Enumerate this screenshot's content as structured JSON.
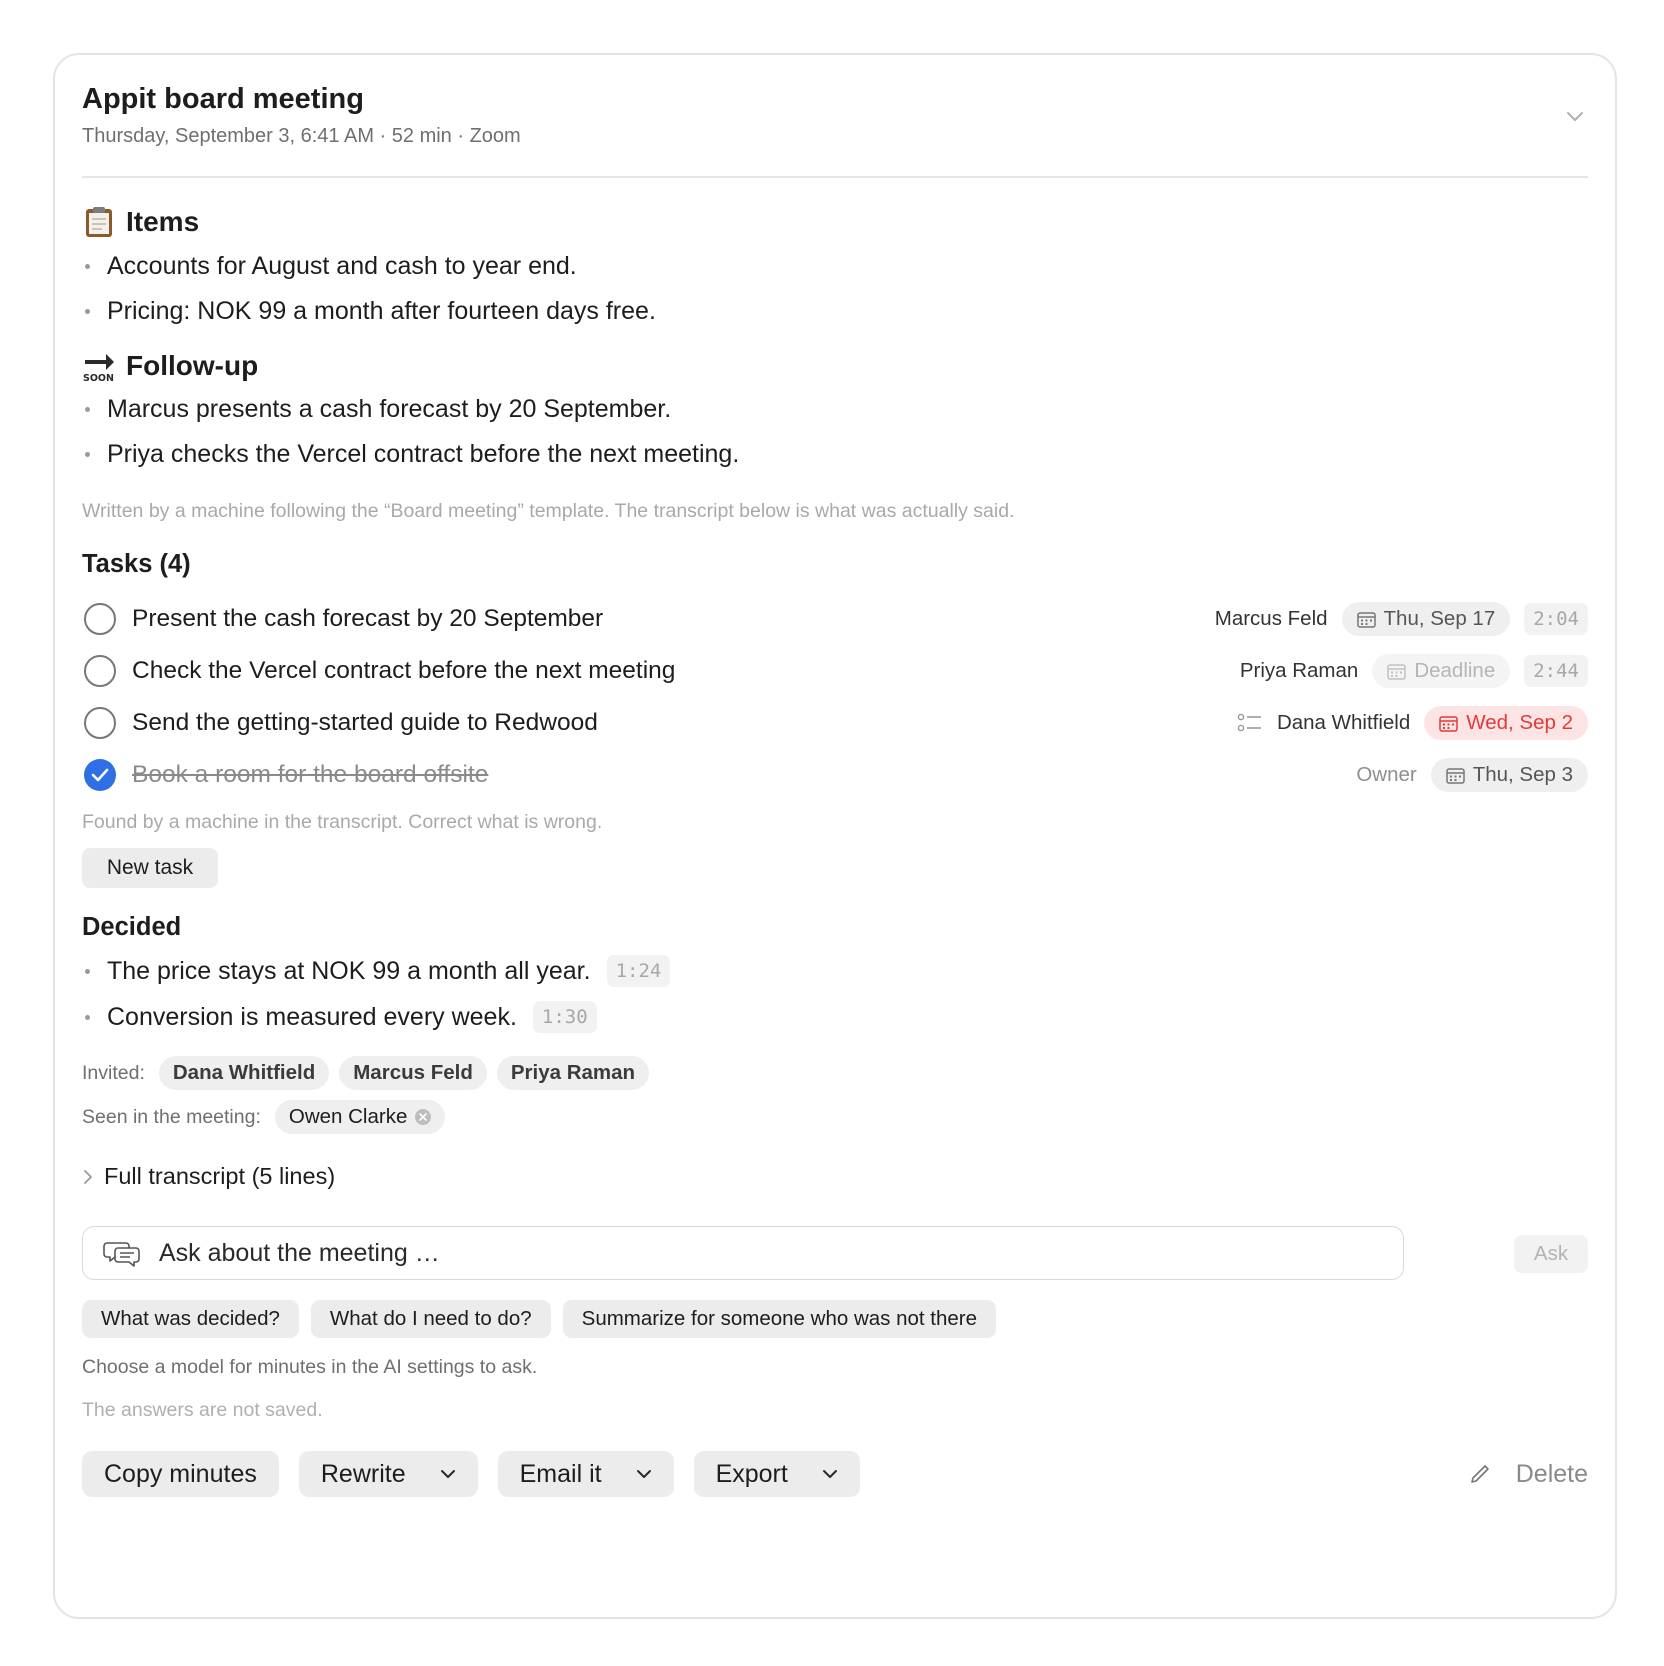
{
  "meeting": {
    "title": "Appit board meeting",
    "subtitle": "Thursday, September 3, 6:41 AM · 52 min · Zoom"
  },
  "summary": {
    "items": {
      "emoji": "clipboard-emoji",
      "heading": "Items",
      "bullets": [
        "Accounts for August and cash to year end.",
        "Pricing: NOK 99 a month after fourteen days free."
      ]
    },
    "followup": {
      "emoji": "soon-arrow-emoji",
      "heading": "Follow-up",
      "bullets": [
        "Marcus presents a cash forecast by 20 September.",
        "Priya checks the Vercel contract before the next meeting."
      ]
    },
    "note": "Written by a machine following the “Board meeting” template. The transcript below is what was actually said."
  },
  "tasks": {
    "heading": "Tasks (4)",
    "items": [
      {
        "text": "Present the cash forecast by 20 September",
        "done": false,
        "owner": "Marcus Feld",
        "date": "Thu, Sep 17",
        "date_state": "normal",
        "stamp": "2:04"
      },
      {
        "text": "Check the Vercel contract before the next meeting",
        "done": false,
        "owner": "Priya Raman",
        "date": "Deadline",
        "date_state": "placeholder",
        "stamp": "2:44"
      },
      {
        "text": "Send the getting-started guide to Redwood",
        "done": false,
        "owner": "Dana Whitfield",
        "date": "Wed, Sep 2",
        "date_state": "overdue",
        "stamp": ""
      },
      {
        "text": "Book a room for the board offsite",
        "done": true,
        "owner": "Owner",
        "date": "Thu, Sep 3",
        "date_state": "normal",
        "stamp": ""
      }
    ],
    "note": "Found by a machine in the transcript. Correct what is wrong.",
    "new_task_label": "New task"
  },
  "decided": {
    "heading": "Decided",
    "items": [
      {
        "text": "The price stays at NOK 99 a month all year.",
        "stamp": "1:24"
      },
      {
        "text": "Conversion is measured every week.",
        "stamp": "1:30"
      }
    ]
  },
  "people": {
    "invited_label": "Invited:",
    "invited": [
      "Dana Whitfield",
      "Marcus Feld",
      "Priya Raman"
    ],
    "seen_label": "Seen in the meeting:",
    "seen": [
      "Owen Clarke"
    ]
  },
  "transcript": {
    "label": "Full transcript (5 lines)"
  },
  "ask": {
    "placeholder": "Ask about the meeting …",
    "button": "Ask",
    "suggestions": [
      "What was decided?",
      "What do I need to do?",
      "Summarize for someone who was not there"
    ],
    "hint": "Choose a model for minutes in the AI settings to ask.",
    "hint2": "The answers are not saved."
  },
  "actions": {
    "copy": "Copy minutes",
    "rewrite": "Rewrite",
    "email": "Email it",
    "export": "Export",
    "delete": "Delete"
  },
  "colors": {
    "accent": "#2f6fe6",
    "overdue": "#e23b3b",
    "overdue_bg": "#fde4e4"
  }
}
